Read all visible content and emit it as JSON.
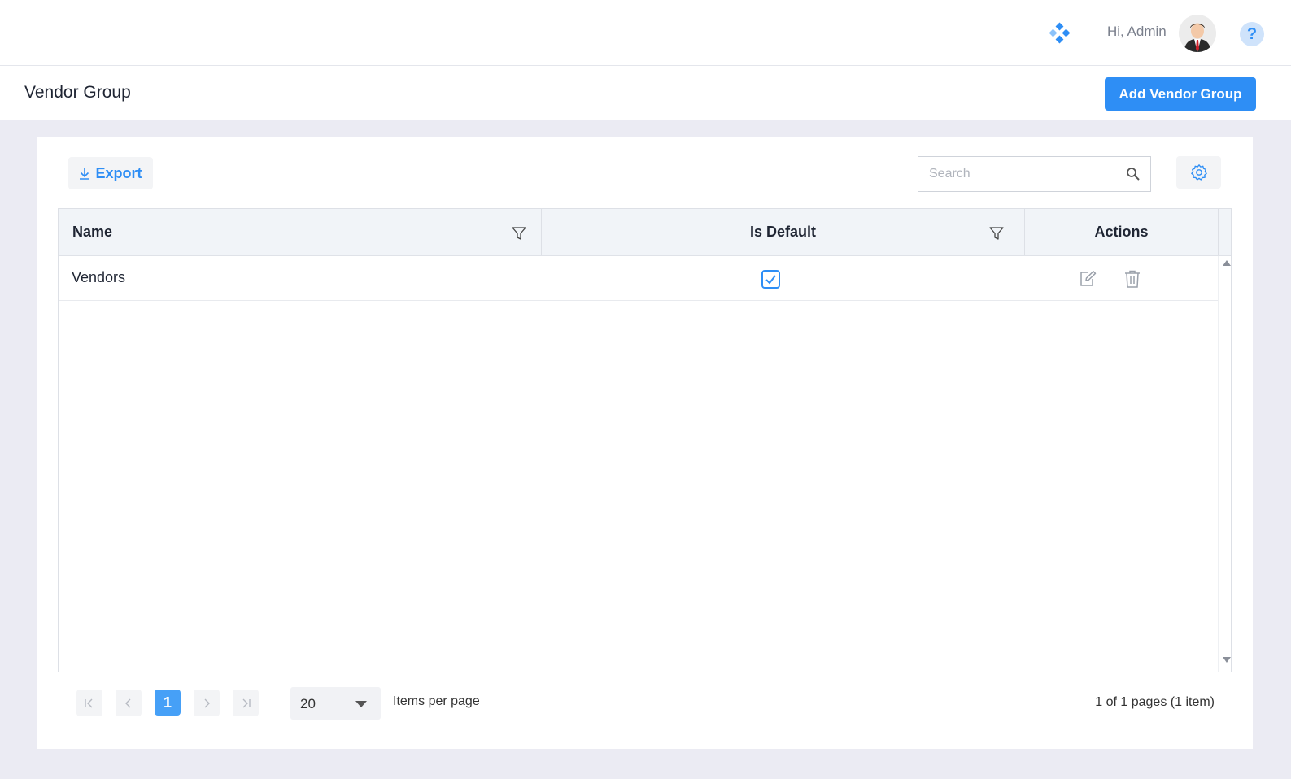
{
  "header": {
    "greeting": "Hi, Admin",
    "help_label": "?"
  },
  "page": {
    "title": "Vendor Group",
    "add_button_label": "Add Vendor Group"
  },
  "toolbar": {
    "export_label": "Export",
    "search_placeholder": "Search"
  },
  "grid": {
    "columns": [
      "Name",
      "Is Default",
      "Actions"
    ],
    "rows": [
      {
        "name": "Vendors",
        "is_default": true
      }
    ]
  },
  "pager": {
    "current_page": "1",
    "page_size": "20",
    "items_per_page_label": "Items per page",
    "info": "1 of 1 pages (1 item)"
  },
  "colors": {
    "accent": "#2e8ef5",
    "page_bg": "#ebebf3",
    "header_bg": "#f1f4f8"
  }
}
